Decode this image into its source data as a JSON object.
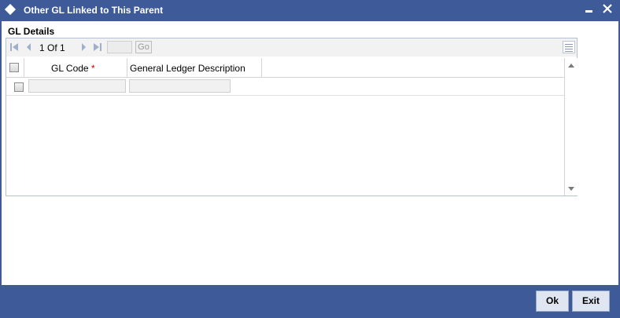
{
  "window": {
    "title": "Other GL Linked to This Parent",
    "minimize_icon": "minimize-icon",
    "close_icon": "close-icon"
  },
  "section": {
    "title": "GL Details"
  },
  "pager": {
    "current_page": "1",
    "of_label": "Of",
    "total_pages": "1",
    "go_label": "Go",
    "page_input_value": ""
  },
  "grid": {
    "columns": [
      {
        "label": "GL Code",
        "required": true
      },
      {
        "label": "General Ledger Description",
        "required": false
      }
    ],
    "rows": [
      {
        "gl_code": "",
        "description": ""
      }
    ]
  },
  "footer": {
    "ok_label": "Ok",
    "exit_label": "Exit"
  },
  "colors": {
    "titlebar": "#3f5a99",
    "button_bg": "#dfe6f1",
    "required_marker": "#cc0000"
  }
}
